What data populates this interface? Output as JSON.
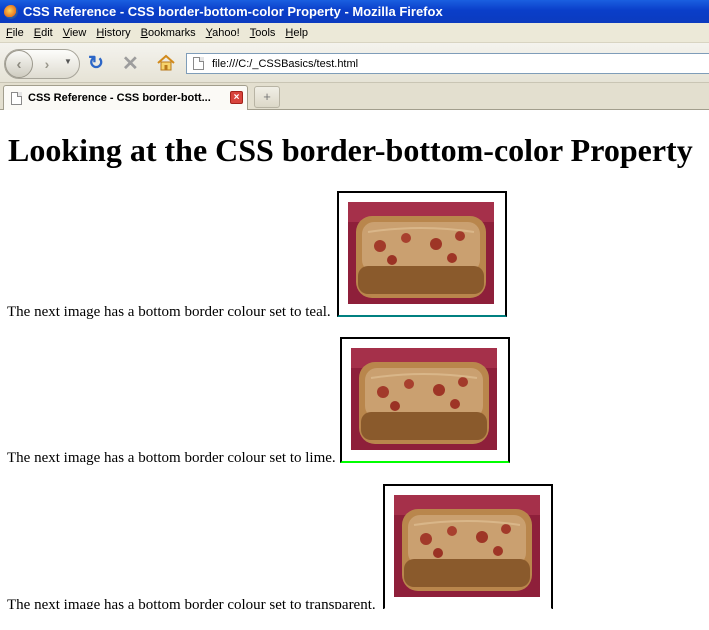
{
  "window": {
    "title": "CSS Reference - CSS border-bottom-color Property - Mozilla Firefox"
  },
  "menu": {
    "items": [
      {
        "key": "F",
        "rest": "ile"
      },
      {
        "key": "E",
        "rest": "dit"
      },
      {
        "key": "V",
        "rest": "iew"
      },
      {
        "key": "H",
        "rest": "istory"
      },
      {
        "key": "B",
        "rest": "ookmarks"
      },
      {
        "key": "Y",
        "rest": "ahoo!"
      },
      {
        "key": "T",
        "rest": "ools"
      },
      {
        "key": "H",
        "rest": "elp"
      }
    ]
  },
  "toolbar": {
    "url": "file:///C:/_CSSBasics/test.html",
    "icons": [
      "back-icon",
      "forward-icon",
      "history-dropdown-icon",
      "reload-icon",
      "stop-icon",
      "home-icon"
    ]
  },
  "tabs": {
    "active_label": "CSS Reference - CSS border-bott...",
    "new_tab_glyph": "+"
  },
  "page": {
    "heading": "Looking at the CSS border-bottom-color Property",
    "items": [
      {
        "caption": "The next image has a bottom border colour set to teal.",
        "border_bottom_color": "#008080"
      },
      {
        "caption": "The next image has a bottom border colour set to lime.",
        "border_bottom_color": "#00ff00"
      },
      {
        "caption": "The next image has a bottom border colour set to transparent.",
        "border_bottom_color": "transparent"
      }
    ]
  }
}
